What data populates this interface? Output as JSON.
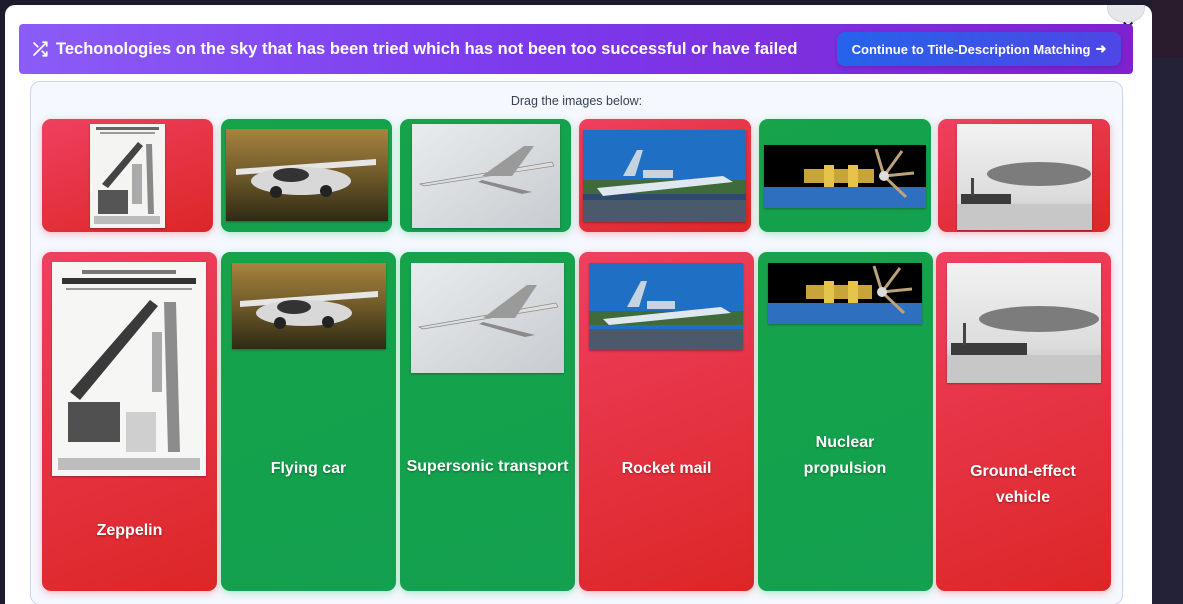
{
  "header": {
    "title": "Techonologies on the sky that has been tried which has not been too successful or have failed",
    "continue_label": "Continue to Title-Description Matching",
    "continue_arrow": "➜"
  },
  "close_label": "×",
  "panel": {
    "drag_label": "Drag the images below:"
  },
  "images": [
    {
      "id": "rocket-mail-poster",
      "status": "failed"
    },
    {
      "id": "flying-car",
      "status": "success"
    },
    {
      "id": "concorde",
      "status": "success"
    },
    {
      "id": "ekranoplan",
      "status": "failed"
    },
    {
      "id": "nuclear-spacecraft",
      "status": "success"
    },
    {
      "id": "zeppelin",
      "status": "failed"
    }
  ],
  "targets": [
    {
      "label": "Zeppelin",
      "status": "failed"
    },
    {
      "label": "Flying car",
      "status": "success"
    },
    {
      "label": "Supersonic transport",
      "status": "success"
    },
    {
      "label": "Rocket mail",
      "status": "failed"
    },
    {
      "label": "Nuclear propulsion",
      "status": "success"
    },
    {
      "label": "Ground-effect vehicle",
      "status": "failed"
    }
  ],
  "colors": {
    "failed": "#e11d48",
    "success": "#16a34a",
    "header_start": "#8b5cf6",
    "button": "#2563eb"
  }
}
